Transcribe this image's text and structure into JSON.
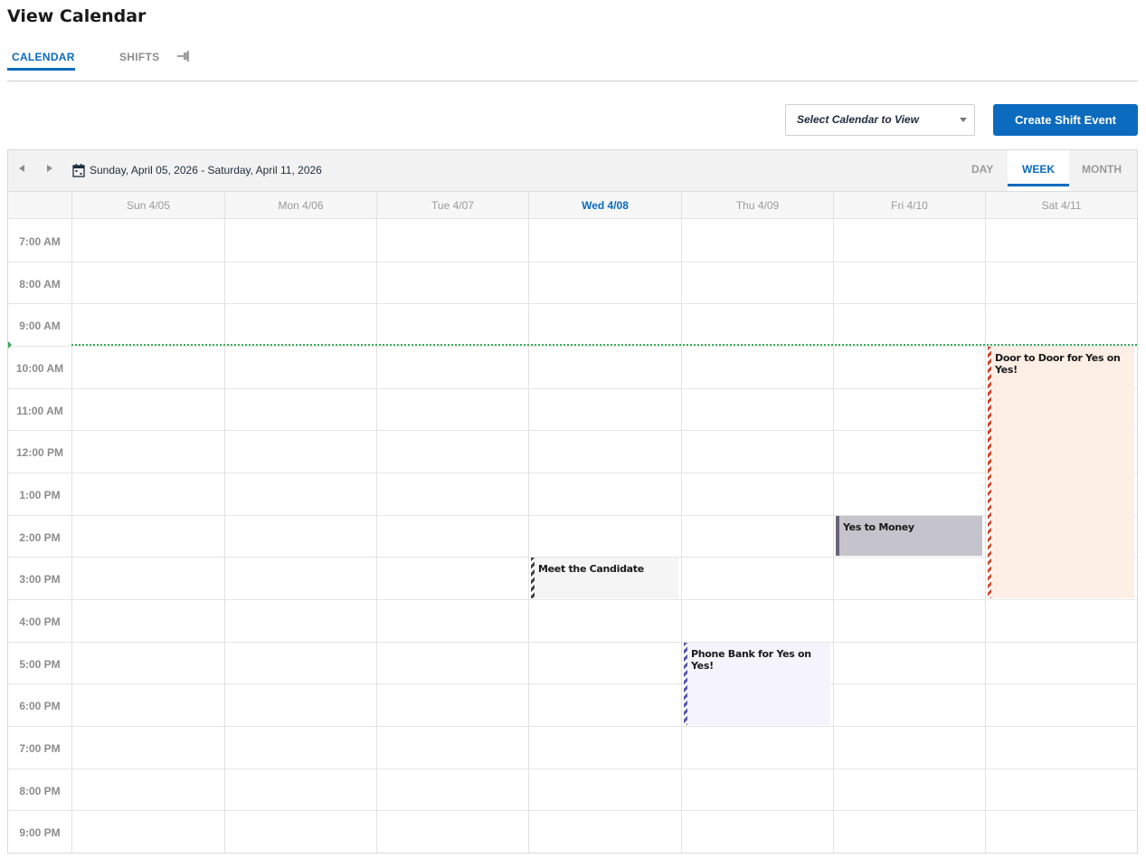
{
  "page": {
    "title": "View Calendar"
  },
  "tabs": [
    {
      "label": "CALENDAR",
      "active": true
    },
    {
      "label": "SHIFTS",
      "active": false
    }
  ],
  "icons": {
    "pin": "pin-icon",
    "calendar": "calendar-icon",
    "prev": "chevron-left-icon",
    "next": "chevron-right-icon",
    "caret": "caret-down-icon"
  },
  "toolbar": {
    "select_placeholder": "Select Calendar to View",
    "create_label": "Create Shift Event",
    "date_range": "Sunday, April 05, 2026 - Saturday, April 11, 2026",
    "views": {
      "day": "DAY",
      "week": "WEEK",
      "month": "MONTH",
      "active": "WEEK"
    }
  },
  "days": [
    {
      "label": "Sun 4/05",
      "today": false
    },
    {
      "label": "Mon 4/06",
      "today": false
    },
    {
      "label": "Tue 4/07",
      "today": false
    },
    {
      "label": "Wed 4/08",
      "today": true
    },
    {
      "label": "Thu 4/09",
      "today": false
    },
    {
      "label": "Fri 4/10",
      "today": false
    },
    {
      "label": "Sat 4/11",
      "today": false
    }
  ],
  "times": [
    "7:00 AM",
    "8:00 AM",
    "9:00 AM",
    "10:00 AM",
    "11:00 AM",
    "12:00 PM",
    "1:00 PM",
    "2:00 PM",
    "3:00 PM",
    "4:00 PM",
    "5:00 PM",
    "6:00 PM",
    "7:00 PM",
    "8:00 PM",
    "9:00 PM"
  ],
  "current_time_line": {
    "hour": 9.95
  },
  "events": [
    {
      "title": "Door to Door for Yes on Yes!",
      "day": 6,
      "start": 10.0,
      "end": 16.0,
      "bg": "#fdeee6",
      "stripe": "#c8492a",
      "striped": true
    },
    {
      "title": "Yes to Money",
      "day": 5,
      "start": 14.0,
      "end": 15.0,
      "bg": "#c5c3cc",
      "stripe": "#6b6478",
      "striped": false
    },
    {
      "title": "Meet the Candidate",
      "day": 3,
      "start": 15.0,
      "end": 16.0,
      "bg": "#f5f5f5",
      "stripe": "#444444",
      "striped": true
    },
    {
      "title": "Phone Bank for Yes on Yes!",
      "day": 4,
      "start": 17.0,
      "end": 19.0,
      "bg": "#f5f4fc",
      "stripe": "#5b57b0",
      "striped": true
    }
  ],
  "colors": {
    "accent": "#0b6bbf",
    "now_line": "#3aaa5a"
  }
}
